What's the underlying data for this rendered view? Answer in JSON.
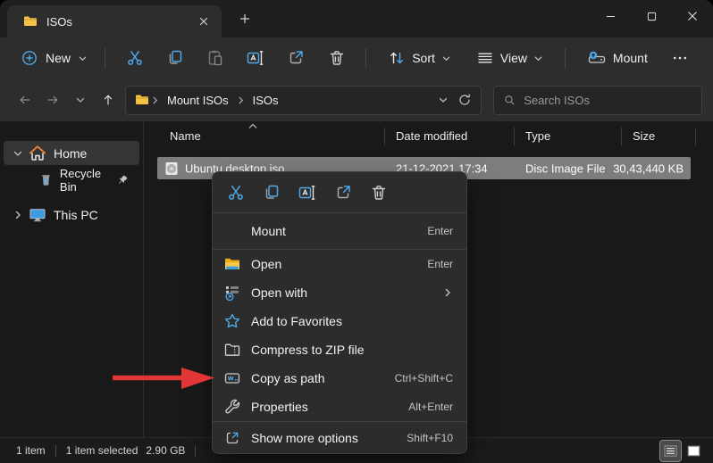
{
  "window": {
    "tab_title": "ISOs"
  },
  "toolbar": {
    "new_label": "New",
    "sort_label": "Sort",
    "view_label": "View",
    "mount_label": "Mount"
  },
  "address_bar": {
    "crumbs": [
      "Mount ISOs",
      "ISOs"
    ],
    "search_placeholder": "Search ISOs"
  },
  "sidebar": {
    "items": [
      {
        "label": "Home"
      },
      {
        "label": "Recycle Bin"
      },
      {
        "label": "This PC"
      }
    ]
  },
  "file_list": {
    "columns": [
      "Name",
      "Date modified",
      "Type",
      "Size"
    ],
    "rows": [
      {
        "name": "Ubuntu desktop.iso",
        "date_modified": "21-12-2021 17:34",
        "type": "Disc Image File",
        "size": "30,43,440 KB"
      }
    ]
  },
  "context_menu": {
    "items": [
      {
        "id": "mount",
        "label": "Mount",
        "shortcut": "Enter"
      },
      {
        "id": "open",
        "label": "Open",
        "shortcut": "Enter"
      },
      {
        "id": "open-with",
        "label": "Open with"
      },
      {
        "id": "add-to-favorites",
        "label": "Add to Favorites"
      },
      {
        "id": "compress-to-zip",
        "label": "Compress to ZIP file"
      },
      {
        "id": "copy-as-path",
        "label": "Copy as path",
        "shortcut": "Ctrl+Shift+C"
      },
      {
        "id": "properties",
        "label": "Properties",
        "shortcut": "Alt+Enter"
      },
      {
        "id": "show-more-options",
        "label": "Show more options",
        "shortcut": "Shift+F10"
      }
    ]
  },
  "status_bar": {
    "item_count": "1 item",
    "selection_count": "1 item selected",
    "selection_size": "2.90 GB"
  },
  "colors": {
    "accent_blue": "#4fa8e8",
    "folder_yellow": "#f5c243",
    "selection_gray": "#7d7d7d",
    "arrow_red": "#e23636",
    "menu_bg": "#2c2c2c",
    "chrome_bg": "#2d2d2d",
    "content_bg": "#191919"
  }
}
